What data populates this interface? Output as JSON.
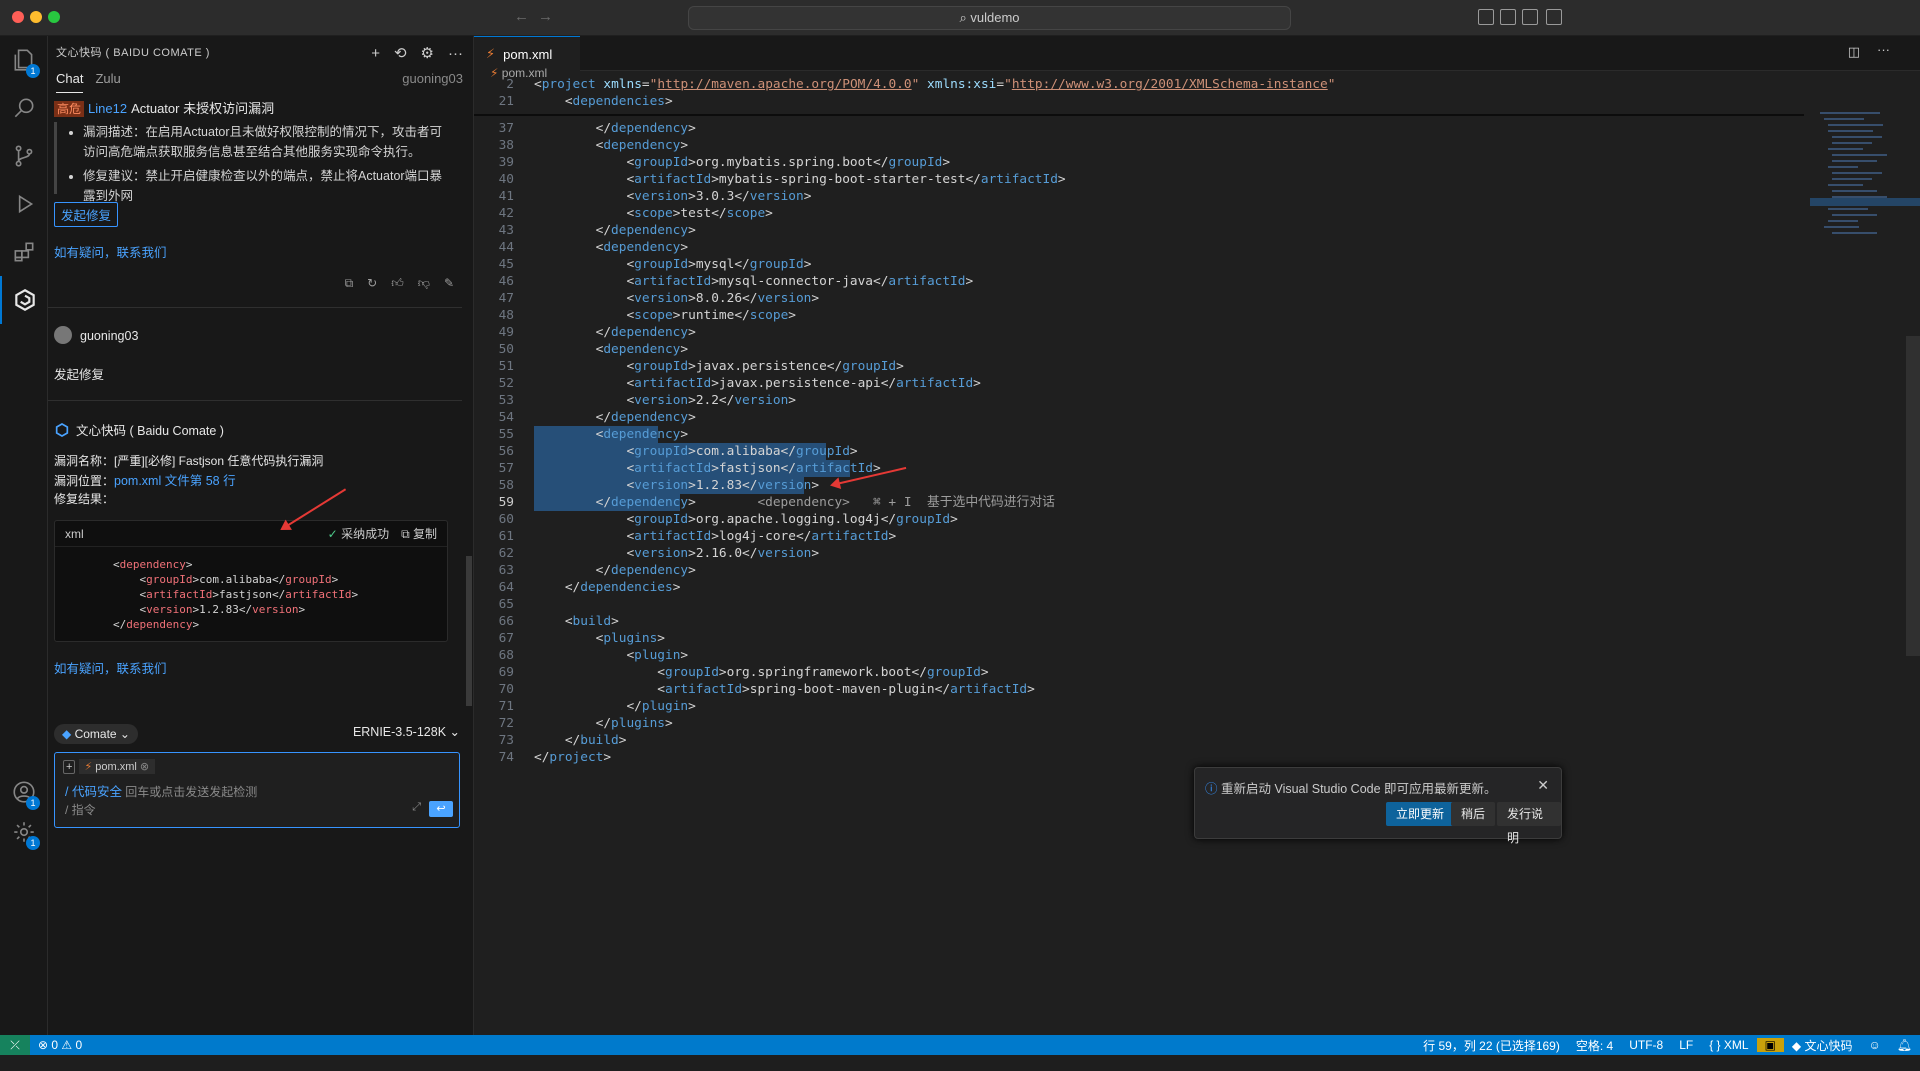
{
  "window": {
    "search_text": "vuldemo"
  },
  "sidebar": {
    "title": "文心快码 ( BAIDU COMATE )",
    "tabs": [
      "Chat",
      "Zulu"
    ],
    "username": "guoning03"
  },
  "chat": {
    "vuln_tag": "高危",
    "vuln_line": "Line12",
    "vuln_title": "Actuator 未授权访问漏洞",
    "desc": "漏洞描述：在启用Actuator且未做好权限控制的情况下，攻击者可访问高危端点获取服务信息甚至结合其他服务实现命令执行。",
    "fix": "修复建议：禁止开启健康检查以外的端点，禁止将Actuator端口暴露到外网",
    "repair_button": "发起修复",
    "contact_link": "如有疑问，联系我们",
    "user_name": "guoning03",
    "user_message": "发起修复",
    "bot_name": "文心快码 ( Baidu Comate )",
    "vuln_name": "漏洞名称：[严重][必修] Fastjson 任意代码执行漏洞",
    "vuln_location_label": "漏洞位置：",
    "vuln_location_link": "pom.xml 文件第 58 行",
    "result_label": "修复结果：",
    "code_lang": "xml",
    "accepted": "采纳成功",
    "copy": "复制",
    "code_lines": [
      "<dependency>",
      "    <groupId>com.alibaba</groupId>",
      "    <artifactId>fastjson</artifactId>",
      "    <version>1.2.83</version>",
      "</dependency>"
    ],
    "contact_link2": "如有疑问，联系我们"
  },
  "input": {
    "agent": "Comate",
    "model": "ERNIE-3.5-128K",
    "file_chip": "pom.xml",
    "command_tag": "/ 代码安全",
    "command_hint": "回车或点击发送发起检测",
    "placeholder": "/ 指令"
  },
  "editor": {
    "tab_name": "pom.xml",
    "breadcrumb": "pom.xml",
    "inline_hint": "⌘ + I  基于选中代码进行对话"
  },
  "notification": {
    "message": "重新启动 Visual Studio Code 即可应用最新更新。",
    "update_now": "立即更新",
    "later": "稍后",
    "release_notes": "发行说明"
  },
  "statusbar": {
    "problems": "⊗ 0 ⚠ 0",
    "cursor": "行 59，列 22 (已选择169)",
    "spaces": "空格: 4",
    "encoding": "UTF-8",
    "eol": "LF",
    "language": "{ } XML",
    "comate": "文心快码"
  }
}
